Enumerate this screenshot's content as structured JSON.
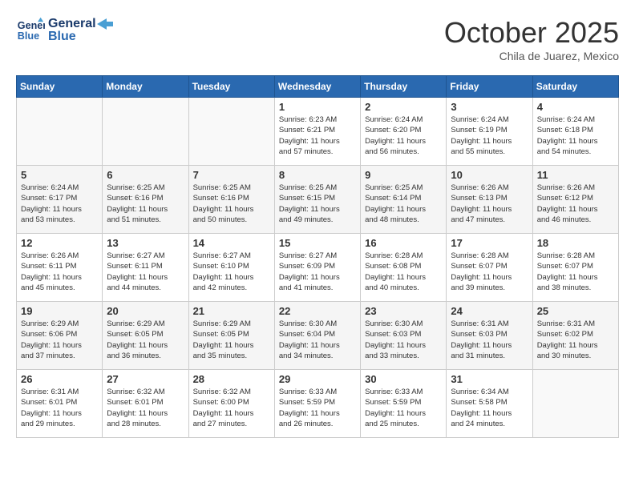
{
  "header": {
    "logo_line1": "General",
    "logo_line2": "Blue",
    "month": "October 2025",
    "location": "Chila de Juarez, Mexico"
  },
  "days_of_week": [
    "Sunday",
    "Monday",
    "Tuesday",
    "Wednesday",
    "Thursday",
    "Friday",
    "Saturday"
  ],
  "weeks": [
    [
      {
        "day": "",
        "info": ""
      },
      {
        "day": "",
        "info": ""
      },
      {
        "day": "",
        "info": ""
      },
      {
        "day": "1",
        "info": "Sunrise: 6:23 AM\nSunset: 6:21 PM\nDaylight: 11 hours\nand 57 minutes."
      },
      {
        "day": "2",
        "info": "Sunrise: 6:24 AM\nSunset: 6:20 PM\nDaylight: 11 hours\nand 56 minutes."
      },
      {
        "day": "3",
        "info": "Sunrise: 6:24 AM\nSunset: 6:19 PM\nDaylight: 11 hours\nand 55 minutes."
      },
      {
        "day": "4",
        "info": "Sunrise: 6:24 AM\nSunset: 6:18 PM\nDaylight: 11 hours\nand 54 minutes."
      }
    ],
    [
      {
        "day": "5",
        "info": "Sunrise: 6:24 AM\nSunset: 6:17 PM\nDaylight: 11 hours\nand 53 minutes."
      },
      {
        "day": "6",
        "info": "Sunrise: 6:25 AM\nSunset: 6:16 PM\nDaylight: 11 hours\nand 51 minutes."
      },
      {
        "day": "7",
        "info": "Sunrise: 6:25 AM\nSunset: 6:16 PM\nDaylight: 11 hours\nand 50 minutes."
      },
      {
        "day": "8",
        "info": "Sunrise: 6:25 AM\nSunset: 6:15 PM\nDaylight: 11 hours\nand 49 minutes."
      },
      {
        "day": "9",
        "info": "Sunrise: 6:25 AM\nSunset: 6:14 PM\nDaylight: 11 hours\nand 48 minutes."
      },
      {
        "day": "10",
        "info": "Sunrise: 6:26 AM\nSunset: 6:13 PM\nDaylight: 11 hours\nand 47 minutes."
      },
      {
        "day": "11",
        "info": "Sunrise: 6:26 AM\nSunset: 6:12 PM\nDaylight: 11 hours\nand 46 minutes."
      }
    ],
    [
      {
        "day": "12",
        "info": "Sunrise: 6:26 AM\nSunset: 6:11 PM\nDaylight: 11 hours\nand 45 minutes."
      },
      {
        "day": "13",
        "info": "Sunrise: 6:27 AM\nSunset: 6:11 PM\nDaylight: 11 hours\nand 44 minutes."
      },
      {
        "day": "14",
        "info": "Sunrise: 6:27 AM\nSunset: 6:10 PM\nDaylight: 11 hours\nand 42 minutes."
      },
      {
        "day": "15",
        "info": "Sunrise: 6:27 AM\nSunset: 6:09 PM\nDaylight: 11 hours\nand 41 minutes."
      },
      {
        "day": "16",
        "info": "Sunrise: 6:28 AM\nSunset: 6:08 PM\nDaylight: 11 hours\nand 40 minutes."
      },
      {
        "day": "17",
        "info": "Sunrise: 6:28 AM\nSunset: 6:07 PM\nDaylight: 11 hours\nand 39 minutes."
      },
      {
        "day": "18",
        "info": "Sunrise: 6:28 AM\nSunset: 6:07 PM\nDaylight: 11 hours\nand 38 minutes."
      }
    ],
    [
      {
        "day": "19",
        "info": "Sunrise: 6:29 AM\nSunset: 6:06 PM\nDaylight: 11 hours\nand 37 minutes."
      },
      {
        "day": "20",
        "info": "Sunrise: 6:29 AM\nSunset: 6:05 PM\nDaylight: 11 hours\nand 36 minutes."
      },
      {
        "day": "21",
        "info": "Sunrise: 6:29 AM\nSunset: 6:05 PM\nDaylight: 11 hours\nand 35 minutes."
      },
      {
        "day": "22",
        "info": "Sunrise: 6:30 AM\nSunset: 6:04 PM\nDaylight: 11 hours\nand 34 minutes."
      },
      {
        "day": "23",
        "info": "Sunrise: 6:30 AM\nSunset: 6:03 PM\nDaylight: 11 hours\nand 33 minutes."
      },
      {
        "day": "24",
        "info": "Sunrise: 6:31 AM\nSunset: 6:03 PM\nDaylight: 11 hours\nand 31 minutes."
      },
      {
        "day": "25",
        "info": "Sunrise: 6:31 AM\nSunset: 6:02 PM\nDaylight: 11 hours\nand 30 minutes."
      }
    ],
    [
      {
        "day": "26",
        "info": "Sunrise: 6:31 AM\nSunset: 6:01 PM\nDaylight: 11 hours\nand 29 minutes."
      },
      {
        "day": "27",
        "info": "Sunrise: 6:32 AM\nSunset: 6:01 PM\nDaylight: 11 hours\nand 28 minutes."
      },
      {
        "day": "28",
        "info": "Sunrise: 6:32 AM\nSunset: 6:00 PM\nDaylight: 11 hours\nand 27 minutes."
      },
      {
        "day": "29",
        "info": "Sunrise: 6:33 AM\nSunset: 5:59 PM\nDaylight: 11 hours\nand 26 minutes."
      },
      {
        "day": "30",
        "info": "Sunrise: 6:33 AM\nSunset: 5:59 PM\nDaylight: 11 hours\nand 25 minutes."
      },
      {
        "day": "31",
        "info": "Sunrise: 6:34 AM\nSunset: 5:58 PM\nDaylight: 11 hours\nand 24 minutes."
      },
      {
        "day": "",
        "info": ""
      }
    ]
  ]
}
